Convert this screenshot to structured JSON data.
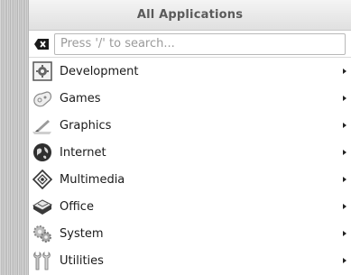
{
  "menu": {
    "title": "All Applications",
    "search": {
      "placeholder": "Press '/' to search...",
      "value": ""
    },
    "items": [
      {
        "label": "Development",
        "icon": "development-icon"
      },
      {
        "label": "Games",
        "icon": "games-icon"
      },
      {
        "label": "Graphics",
        "icon": "graphics-icon"
      },
      {
        "label": "Internet",
        "icon": "internet-icon"
      },
      {
        "label": "Multimedia",
        "icon": "multimedia-icon"
      },
      {
        "label": "Office",
        "icon": "office-icon"
      },
      {
        "label": "System",
        "icon": "system-icon"
      },
      {
        "label": "Utilities",
        "icon": "utilities-icon"
      }
    ]
  }
}
